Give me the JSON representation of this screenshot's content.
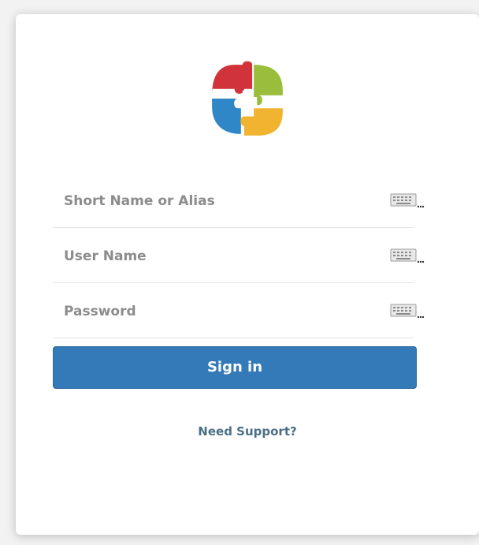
{
  "login": {
    "short_name_placeholder": "Short Name or Alias",
    "user_name_placeholder": "User Name",
    "password_placeholder": "Password",
    "sign_in_label": "Sign in",
    "support_link": "Need Support?"
  },
  "icons": {
    "logo": "puzzle-plus-logo",
    "keyboard": "keyboard-icon"
  },
  "colors": {
    "primary_button": "#3479b8",
    "support_link": "#4d6f86",
    "logo_red": "#d0343a",
    "logo_green": "#9bbd3c",
    "logo_blue": "#2f87c8",
    "logo_yellow": "#f0b431"
  }
}
